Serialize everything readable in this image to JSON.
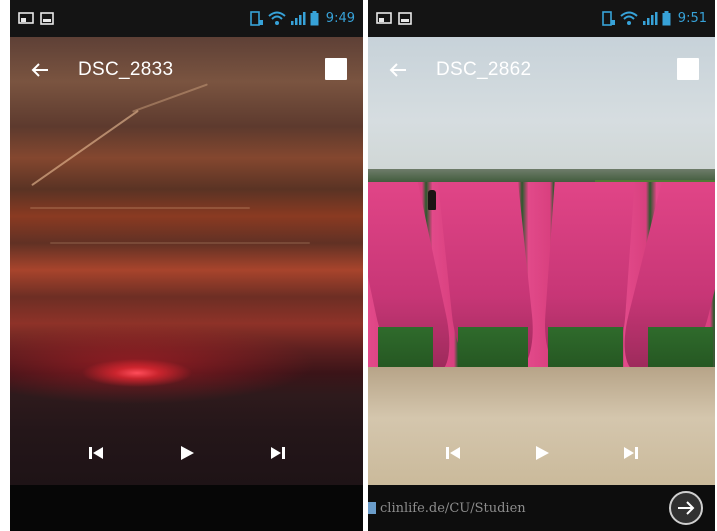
{
  "screens": [
    {
      "status_time": "9:49",
      "title": "DSC_2833",
      "photo": "sunset over sea",
      "controls": [
        "previous",
        "play",
        "next"
      ]
    },
    {
      "status_time": "9:51",
      "title": "DSC_2862",
      "photo": "tulip field",
      "controls": [
        "previous",
        "play",
        "next"
      ],
      "ad": {
        "text": "clinlife.de/CU/Studien",
        "arrow_icon": "arrow-right-icon"
      }
    }
  ],
  "colors": {
    "status_bar": "#141414",
    "status_icons": "#37a2d8",
    "title_text": "#ffffff"
  }
}
